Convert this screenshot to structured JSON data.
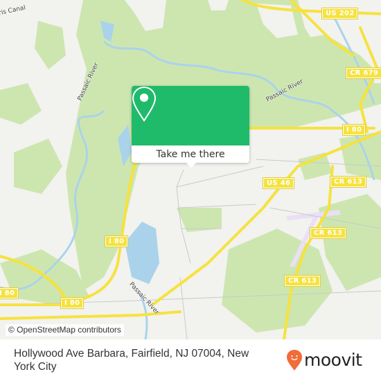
{
  "map": {
    "colors": {
      "background": "#f2f2ef",
      "park": "#cde6b0",
      "water": "#aad3eb",
      "highway": "#f6e23d",
      "airport": "#e9e0f5",
      "minor_road": "#c9c9c9"
    },
    "road_shields": [
      {
        "label": "US 202"
      },
      {
        "label": "CR 679"
      },
      {
        "label": "I 80"
      },
      {
        "label": "US 46"
      },
      {
        "label": "CR 613"
      },
      {
        "label": "CR 613"
      },
      {
        "label": "CR 613"
      },
      {
        "label": "I 80"
      },
      {
        "label": "I 80"
      },
      {
        "label": "I 80"
      }
    ],
    "water_labels": [
      {
        "label": "Passaic River"
      },
      {
        "label": "Passaic River"
      },
      {
        "label": "Passaic River"
      },
      {
        "label": "Morris Canal"
      }
    ],
    "attribution": "© OpenStreetMap contributors"
  },
  "popup": {
    "icon": "map-pin-icon",
    "accent": "#1fbb6a",
    "button_label": "Take me there"
  },
  "footer": {
    "address": "Hollywood Ave Barbara, Fairfield, NJ 07004, New York City",
    "brand": "moovit",
    "brand_icon": "moovit-pin-logo-icon",
    "brand_color": "#f26b3a"
  }
}
